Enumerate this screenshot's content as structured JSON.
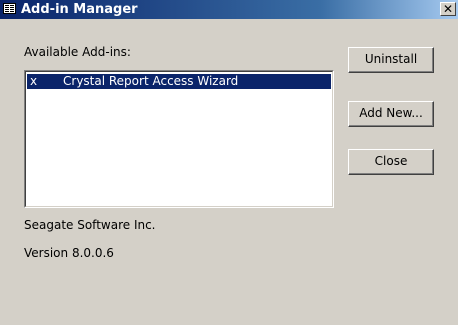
{
  "window": {
    "title": "Add-in Manager",
    "close_glyph": "✕",
    "icon": "window-app-icon"
  },
  "list": {
    "label": "Available Add-ins:",
    "items": [
      {
        "mark": "x",
        "name": "Crystal Report Access Wizard",
        "selected": true
      }
    ]
  },
  "buttons": {
    "uninstall": "Uninstall",
    "add_new": "Add New...",
    "close": "Close"
  },
  "info": {
    "vendor": "Seagate Software Inc.",
    "version": "Version 8.0.0.6"
  },
  "colors": {
    "title_bar_start": "#0a246a",
    "title_bar_end": "#a6caf0",
    "dialog_face": "#d4d0c8",
    "selection": "#0a246a"
  }
}
